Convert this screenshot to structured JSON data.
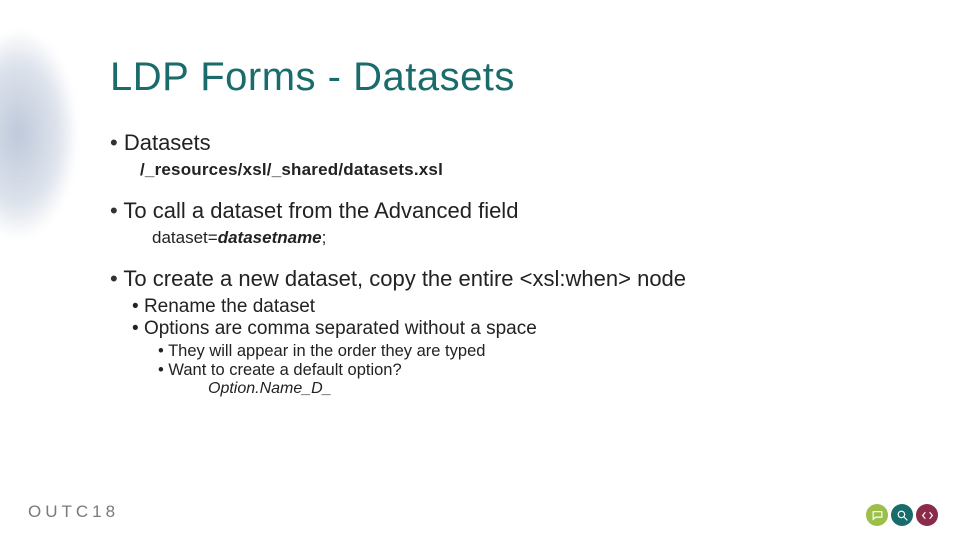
{
  "title": "LDP Forms - Datasets",
  "bullets": {
    "b1": {
      "label": "Datasets",
      "path": "/_resources/xsl/_shared/datasets.xsl"
    },
    "b2": {
      "label": "To call a dataset from the Advanced field",
      "prefix": "dataset=",
      "var": "datasetname",
      "suffix": ";"
    },
    "b3": {
      "label_pre": "To create a new dataset, copy the entire ",
      "label_tag": "<xsl:when>",
      "label_post": " node",
      "sub1": "Rename the dataset",
      "sub2": "Options are comma separated without a space",
      "sub2a": "They will appear in the order they are typed",
      "sub2b": "Want to create a default option?",
      "sub2b_code": "Option.Name_D_"
    }
  },
  "footer": {
    "left": "OUTC18",
    "icons": [
      "chat-icon",
      "search-icon",
      "code-icon"
    ]
  }
}
